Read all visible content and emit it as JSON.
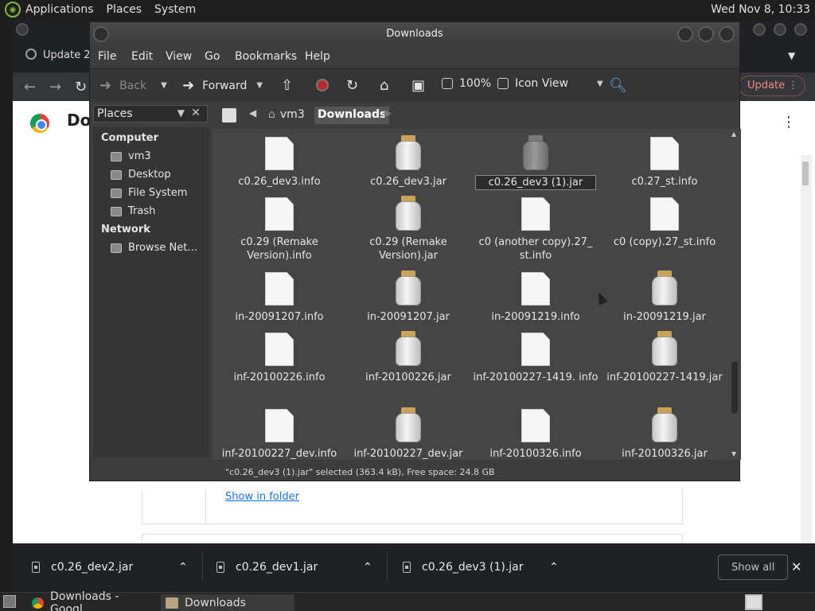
{
  "top_panel": {
    "menus": [
      "Applications",
      "Places",
      "System"
    ],
    "clock": "Wed Nov 8, 10:33"
  },
  "chrome": {
    "tab_label": "Update 2",
    "page_header": "Do",
    "update_label": "Update",
    "show_in_folder": "Show in folder"
  },
  "shelf": {
    "items": [
      {
        "name": "c0.26_dev2.jar"
      },
      {
        "name": "c0.26_dev1.jar"
      },
      {
        "name": "c0.26_dev3 (1).jar"
      }
    ],
    "show_all": "Show all"
  },
  "taskbar": {
    "tasks": [
      {
        "label": "Downloads - Googl…"
      },
      {
        "label": "Downloads"
      }
    ]
  },
  "file_manager": {
    "title": "Downloads",
    "menu": [
      "File",
      "Edit",
      "View",
      "Go",
      "Bookmarks",
      "Help"
    ],
    "toolbar": {
      "back": "Back",
      "forward": "Forward",
      "zoom": "100%",
      "view_mode": "Icon View"
    },
    "places_header": "Places",
    "sidebar": {
      "computer_section": "Computer",
      "computer_items": [
        "vm3",
        "Desktop",
        "File System",
        "Trash"
      ],
      "network_section": "Network",
      "network_items": [
        "Browse Net…"
      ]
    },
    "path": [
      "vm3",
      "Downloads"
    ],
    "files": [
      {
        "name": "c0.26_dev3.info",
        "type": "doc"
      },
      {
        "name": "c0.26_dev3.jar",
        "type": "jar"
      },
      {
        "name": "c0.26_dev3 (1).jar",
        "type": "jar-selected"
      },
      {
        "name": "c0.27_st.info",
        "type": "doc"
      },
      {
        "name": "c0.29 (Remake Version).info",
        "type": "doc"
      },
      {
        "name": "c0.29 (Remake Version).jar",
        "type": "jar"
      },
      {
        "name": "c0 (another copy).27_ st.info",
        "type": "doc"
      },
      {
        "name": "c0 (copy).27_st.info",
        "type": "doc"
      },
      {
        "name": "in-20091207.info",
        "type": "doc"
      },
      {
        "name": "in-20091207.jar",
        "type": "jar"
      },
      {
        "name": "in-20091219.info",
        "type": "doc"
      },
      {
        "name": "in-20091219.jar",
        "type": "jar"
      },
      {
        "name": "inf-20100226.info",
        "type": "doc"
      },
      {
        "name": "inf-20100226.jar",
        "type": "jar"
      },
      {
        "name": "inf-20100227-1419. info",
        "type": "doc"
      },
      {
        "name": "inf-20100227-1419.jar",
        "type": "jar"
      },
      {
        "name": "inf-20100227_dev.info",
        "type": "doc"
      },
      {
        "name": "inf-20100227_dev.jar",
        "type": "jar"
      },
      {
        "name": "inf-20100326.info",
        "type": "doc"
      },
      {
        "name": "inf-20100326.jar",
        "type": "jar"
      }
    ],
    "status": "\"c0.26_dev3 (1).jar\" selected (363.4 kB), Free space: 24.8 GB"
  }
}
